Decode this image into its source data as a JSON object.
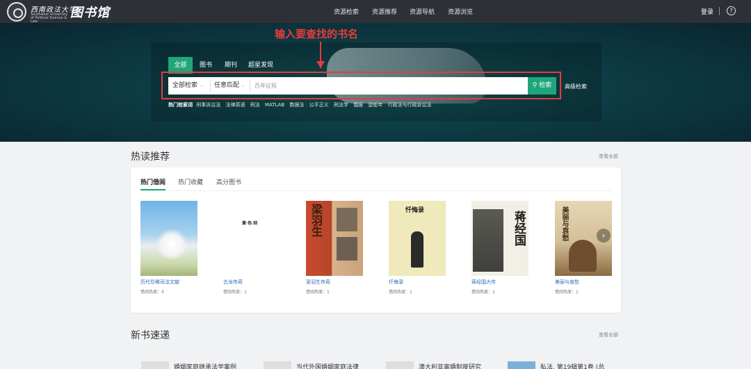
{
  "header": {
    "logo_cn": "西南政法大学",
    "logo_en": "Southwest University of Political Science & Law",
    "logo_library": "图书馆",
    "nav": [
      "资源检索",
      "资源推荐",
      "资源导航",
      "资源浏览"
    ],
    "login": "登录",
    "help": "?"
  },
  "hero": {
    "annotation": "输入要查找的书名",
    "tabs": [
      "全部",
      "图书",
      "期刊",
      "超星发现"
    ],
    "active_tab": 0,
    "scope_select": "全部检索",
    "match_select": "任意匹配",
    "search_value": "百年征程",
    "search_button": "检索",
    "advanced": "高级检索",
    "hot_label": "热门检索词",
    "hot_words": [
      "刑事诉讼法",
      "法律英语",
      "刑法",
      "MATLAB",
      "数据法",
      "公平正义",
      "刑法学",
      "饿报",
      "逆蛇年",
      "行政法与行政诉讼法"
    ]
  },
  "hot_reading": {
    "title": "热读推荐",
    "view_all": "查看全部",
    "tabs": [
      "热门借阅",
      "热门收藏",
      "高分图书"
    ],
    "active_tab": 0,
    "books": [
      {
        "title": "历代珍稀司法文献",
        "meta": "借阅热度：4"
      },
      {
        "title": "古龙传奇",
        "meta": "借阅热度：1",
        "cover_text": "黄·色·剑"
      },
      {
        "title": "梁羽生传奇",
        "meta": "借阅热度：1",
        "cover_text": "梁羽生"
      },
      {
        "title": "忏悔录",
        "meta": "借阅热度：1",
        "cover_text": "忏悔录"
      },
      {
        "title": "蒋经国大传",
        "meta": "借阅热度：1",
        "cover_text": "蒋经国"
      },
      {
        "title": "美丽与哀愁",
        "meta": "借阅热度：1",
        "cover_text": "美丽与哀愁"
      }
    ],
    "next_icon": "›"
  },
  "new_books": {
    "title": "新书速递",
    "view_all": "查看全部",
    "items": [
      "婚姻家庭继承法学案例",
      "当代外国婚姻家庭法律",
      "澳大利亚离婚制度研究",
      "私法. 第19辑第1卷 (总"
    ]
  },
  "colors": {
    "accent": "#1fa67a",
    "annotation": "#e63c3c",
    "topbar": "#2d3037",
    "link": "#2c6bb6"
  }
}
